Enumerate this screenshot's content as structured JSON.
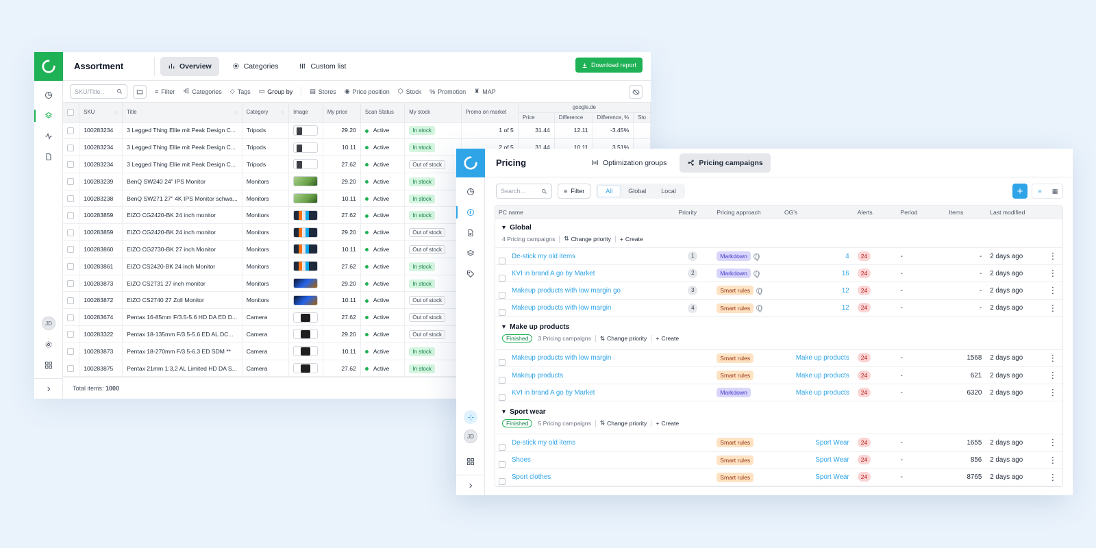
{
  "assortment": {
    "title": "Assortment",
    "tabs": [
      {
        "label": "Overview",
        "icon": "bar-chart-icon"
      },
      {
        "label": "Categories",
        "icon": "gear-icon"
      },
      {
        "label": "Custom list",
        "icon": "sliders-icon"
      }
    ],
    "download_label": "Download report",
    "search_placeholder": "SKU/Title..",
    "tools": [
      "Filter",
      "Categories",
      "Tags",
      "Group by",
      "Stores",
      "Price position",
      "Stock",
      "Promotion",
      "MAP"
    ],
    "columns": {
      "sku": "SKU",
      "title": "Title",
      "category": "Category",
      "image": "Image",
      "my_price": "My price",
      "scan_status": "Scan Status",
      "my_stock": "My stock",
      "promo": "Promo on market",
      "group": "google.de",
      "price": "Price",
      "difference": "Difference",
      "difference_pct": "Difference, %",
      "stock_short": "Sto"
    },
    "rows": [
      {
        "sku": "100283234",
        "title": "3 Legged Thing Ellie mit Peak Design C...",
        "category": "Tripods",
        "thumb": "tripod",
        "price": "29.20",
        "status": "Active",
        "stock": "In stock",
        "promo": "1 of 5",
        "market_price": "31.44",
        "diff": "12.11",
        "diff_pct": "-3.45%"
      },
      {
        "sku": "100283234",
        "title": "3 Legged Thing Ellie mit Peak Design C...",
        "category": "Tripods",
        "thumb": "tripod",
        "price": "10.11",
        "status": "Active",
        "stock": "In stock",
        "promo": "2 of 5",
        "market_price": "31.44",
        "diff": "10.11",
        "diff_pct": "3.51%"
      },
      {
        "sku": "100283234",
        "title": "3 Legged Thing Ellie mit Peak Design C...",
        "category": "Tripods",
        "thumb": "tripod",
        "price": "27.62",
        "status": "Active",
        "stock": "Out of stock"
      },
      {
        "sku": "100283239",
        "title": "BenQ SW240 24\" IPS Monitor",
        "category": "Monitors",
        "thumb": "monitor-a",
        "price": "29.20",
        "status": "Active",
        "stock": "In stock"
      },
      {
        "sku": "100283238",
        "title": "BenQ SW271 27\" 4K IPS Monitor schwa...",
        "category": "Monitors",
        "thumb": "monitor-a",
        "price": "10.11",
        "status": "Active",
        "stock": "In stock"
      },
      {
        "sku": "100283859",
        "title": "EIZO CG2420-BK 24 inch monitor",
        "category": "Monitors",
        "thumb": "monitor-b",
        "price": "27.62",
        "status": "Active",
        "stock": "In stock"
      },
      {
        "sku": "100283859",
        "title": "EIZO CG2420-BK 24 inch monitor",
        "category": "Monitors",
        "thumb": "monitor-b",
        "price": "29.20",
        "status": "Active",
        "stock": "Out of stock"
      },
      {
        "sku": "100283860",
        "title": "EIZO CG2730-BK 27 inch Monitor",
        "category": "Monitors",
        "thumb": "monitor-b",
        "price": "10.11",
        "status": "Active",
        "stock": "Out of stock"
      },
      {
        "sku": "100283861",
        "title": "EIZO CS2420-BK 24 inch Monitor",
        "category": "Monitors",
        "thumb": "monitor-b",
        "price": "27.62",
        "status": "Active",
        "stock": "In stock"
      },
      {
        "sku": "100283873",
        "title": "EIZO CS2731 27 inch monitor",
        "category": "Monitors",
        "thumb": "monitor-c",
        "price": "29.20",
        "status": "Active",
        "stock": "In stock"
      },
      {
        "sku": "100283872",
        "title": "EIZO CS2740 27 Zoll Monitor",
        "category": "Monitors",
        "thumb": "monitor-c",
        "price": "10.11",
        "status": "Active",
        "stock": "Out of stock"
      },
      {
        "sku": "100283674",
        "title": "Pentax 16-85mm F/3.5-5.6 HD DA ED D...",
        "category": "Camera",
        "thumb": "camera",
        "price": "27.62",
        "status": "Active",
        "stock": "Out of stock"
      },
      {
        "sku": "100283322",
        "title": "Pentax 18-135mm F/3.5-5.6 ED AL DC...",
        "category": "Camera",
        "thumb": "camera",
        "price": "29.20",
        "status": "Active",
        "stock": "Out of stock"
      },
      {
        "sku": "100283873",
        "title": "Pentax 18-270mm F/3.5-6.3 ED SDM **",
        "category": "Camera",
        "thumb": "camera",
        "price": "10.11",
        "status": "Active",
        "stock": "In stock"
      },
      {
        "sku": "100283875",
        "title": "Pentax 21mm 1:3,2 AL Limited HD DA S...",
        "category": "Camera",
        "thumb": "camera",
        "price": "27.62",
        "status": "Active",
        "stock": "In stock"
      }
    ],
    "total_label": "Total items:",
    "total_value": "1000",
    "avatar": "JD"
  },
  "pricing": {
    "title": "Pricing",
    "tabs": [
      {
        "label": "Optimization groups",
        "icon": "columns-icon"
      },
      {
        "label": "Pricing campaigns",
        "icon": "share-icon"
      }
    ],
    "search_placeholder": "Search...",
    "filter_label": "Filter",
    "segments": [
      "All",
      "Global",
      "Local"
    ],
    "columns": [
      "PC name",
      "Priority",
      "Pricing approach",
      "OG's",
      "Alerts",
      "Period",
      "Items",
      "Last modified"
    ],
    "change_priority": "Change priority",
    "create": "Create",
    "finished": "Finished",
    "groups": [
      {
        "name": "Global",
        "meta": "4 Pricing campaigns",
        "finished": false,
        "rows": [
          {
            "name": "De-stick my old items",
            "priority": "1",
            "approach": "Markdown",
            "globe": true,
            "ogs": "4",
            "alerts": "24",
            "period": "-",
            "items": "-",
            "modified": "2 days ago"
          },
          {
            "name": "KVI in brand A go by Market",
            "priority": "2",
            "approach": "Markdown",
            "globe": true,
            "ogs": "16",
            "alerts": "24",
            "period": "-",
            "items": "-",
            "modified": "2 days ago"
          },
          {
            "name": "Makeup products with low margin go",
            "priority": "3",
            "approach": "Smart rules",
            "globe": true,
            "ogs": "12",
            "alerts": "24",
            "period": "-",
            "items": "-",
            "modified": "2 days ago"
          },
          {
            "name": "Makeup products with low margin",
            "priority": "4",
            "approach": "Smart rules",
            "globe": true,
            "ogs": "12",
            "alerts": "24",
            "period": "-",
            "items": "-",
            "modified": "2 days ago"
          }
        ]
      },
      {
        "name": "Make up products",
        "meta": "3 Pricing campaigns",
        "finished": true,
        "rows": [
          {
            "name": "Makeup products with low margin",
            "priority": "",
            "approach": "Smart rules",
            "globe": false,
            "ogs": "Make up products",
            "alerts": "24",
            "period": "-",
            "items": "1568",
            "modified": "2 days ago"
          },
          {
            "name": "Makeup products",
            "priority": "",
            "approach": "Smart rules",
            "globe": false,
            "ogs": "Make up products",
            "alerts": "24",
            "period": "-",
            "items": "621",
            "modified": "2 days ago"
          },
          {
            "name": "KVI in brand A go by Market",
            "priority": "",
            "approach": "Markdown",
            "globe": false,
            "ogs": "Make up products",
            "alerts": "24",
            "period": "-",
            "items": "6320",
            "modified": "2 days ago"
          }
        ]
      },
      {
        "name": "Sport wear",
        "meta": "5 Pricing campaigns",
        "finished": true,
        "rows": [
          {
            "name": "De-stick my old items",
            "priority": "",
            "approach": "Smart rules",
            "globe": false,
            "ogs": "Sport Wear",
            "alerts": "24",
            "period": "-",
            "items": "1655",
            "modified": "2 days ago"
          },
          {
            "name": "Shoes",
            "priority": "",
            "approach": "Smart rules",
            "globe": false,
            "ogs": "Sport Wear",
            "alerts": "24",
            "period": "-",
            "items": "856",
            "modified": "2 days ago"
          },
          {
            "name": "Sport clothes",
            "priority": "",
            "approach": "Smart rules",
            "globe": false,
            "ogs": "Sport Wear",
            "alerts": "24",
            "period": "-",
            "items": "8765",
            "modified": "2 days ago"
          }
        ]
      }
    ],
    "avatar": "JD"
  }
}
